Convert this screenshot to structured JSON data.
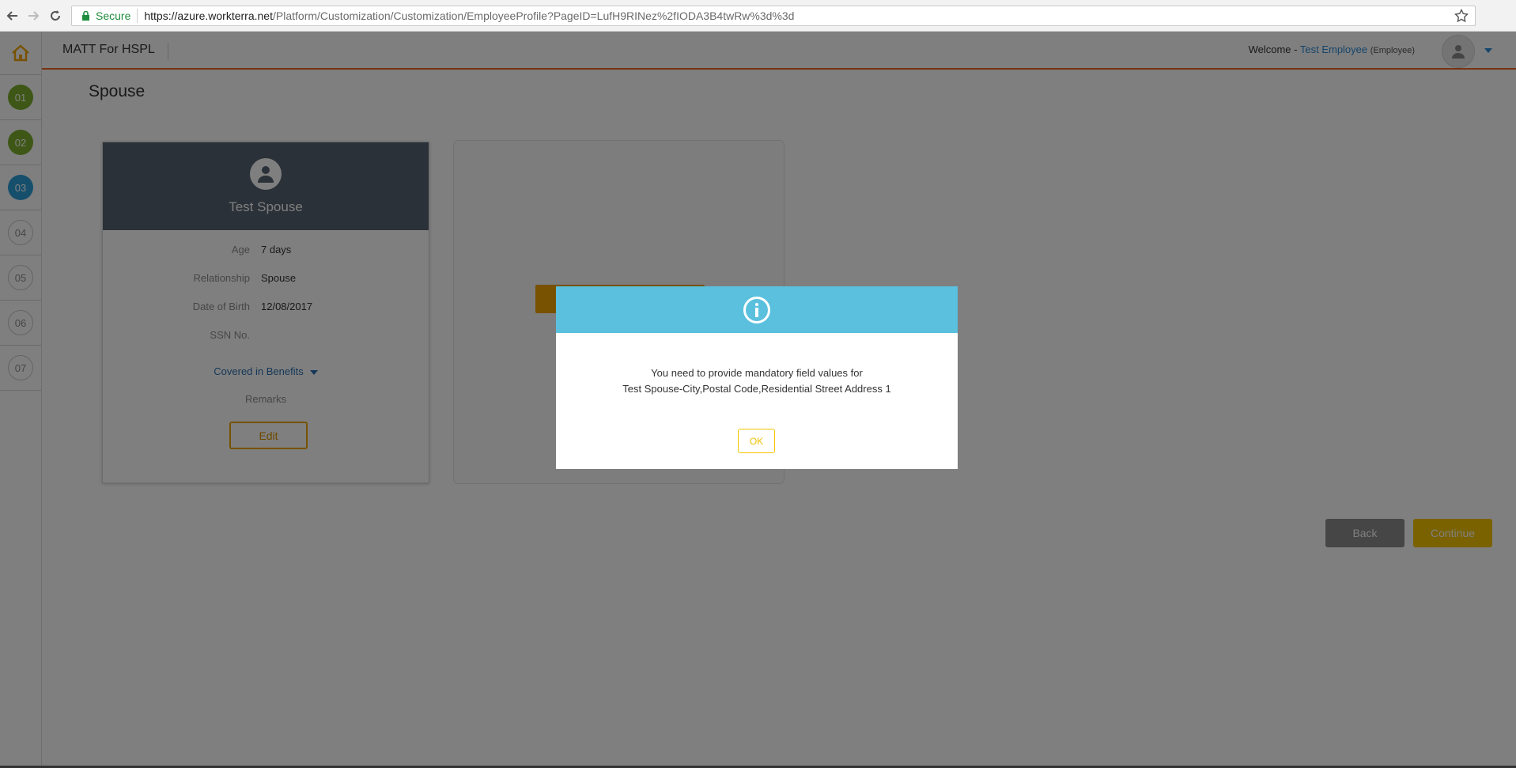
{
  "browser": {
    "secure_label": "Secure",
    "url_host": "https://azure.workterra.net",
    "url_path": "/Platform/Customization/Customization/EmployeeProfile?PageID=LufH9RINez%2fIODA3B4twRw%3d%3d"
  },
  "header": {
    "brand": "MATT For HSPL",
    "welcome_prefix": "Welcome - ",
    "user_name": "Test Employee",
    "user_role": "(Employee)"
  },
  "steps": [
    "01",
    "02",
    "03",
    "04",
    "05",
    "06",
    "07"
  ],
  "page": {
    "title": "Spouse"
  },
  "card": {
    "name": "Test Spouse",
    "age_label": "Age",
    "age_value": "7 days",
    "relationship_label": "Relationship",
    "relationship_value": "Spouse",
    "dob_label": "Date of Birth",
    "dob_value": "12/08/2017",
    "ssn_label": "SSN No.",
    "ssn_value": "",
    "covered_label": "Covered in Benefits",
    "remarks_label": "Remarks",
    "edit_label": "Edit"
  },
  "footer_buttons": {
    "back": "Back",
    "continue": "Continue"
  },
  "modal": {
    "line1": "You need to provide mandatory field values for",
    "line2": "Test Spouse-City,Postal Code,Residential Street Address 1",
    "ok_label": "OK"
  },
  "colors": {
    "accent_orange": "#f26522",
    "step_done": "#7cae2d",
    "step_active": "#2a9fd8",
    "modal_header": "#5bc0de",
    "button_yellow": "#f0a500"
  }
}
